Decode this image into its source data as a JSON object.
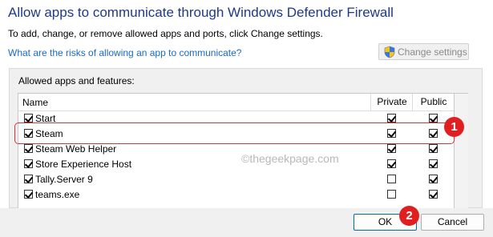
{
  "header": {
    "title": "Allow apps to communicate through Windows Defender Firewall",
    "subtitle": "To add, change, or remove allowed apps and ports, click Change settings.",
    "risk_link": "What are the risks of allowing an app to communicate?",
    "change_settings_label": "Change settings"
  },
  "group": {
    "label": "Allowed apps and features:",
    "columns": {
      "name": "Name",
      "private": "Private",
      "public": "Public"
    },
    "rows": [
      {
        "name": "Start",
        "enabled": true,
        "private": true,
        "public": true
      },
      {
        "name": "Steam",
        "enabled": true,
        "private": true,
        "public": true
      },
      {
        "name": "Steam Web Helper",
        "enabled": true,
        "private": true,
        "public": true
      },
      {
        "name": "Store Experience Host",
        "enabled": true,
        "private": true,
        "public": true
      },
      {
        "name": "Tally.Server 9",
        "enabled": true,
        "private": false,
        "public": true
      },
      {
        "name": "teams.exe",
        "enabled": true,
        "private": false,
        "public": true
      }
    ]
  },
  "annotations": {
    "badge1": "1",
    "badge2": "2",
    "highlight_color": "#e03131"
  },
  "watermark": "©thegeekpage.com",
  "footer": {
    "ok_label": "OK",
    "cancel_label": "Cancel"
  }
}
